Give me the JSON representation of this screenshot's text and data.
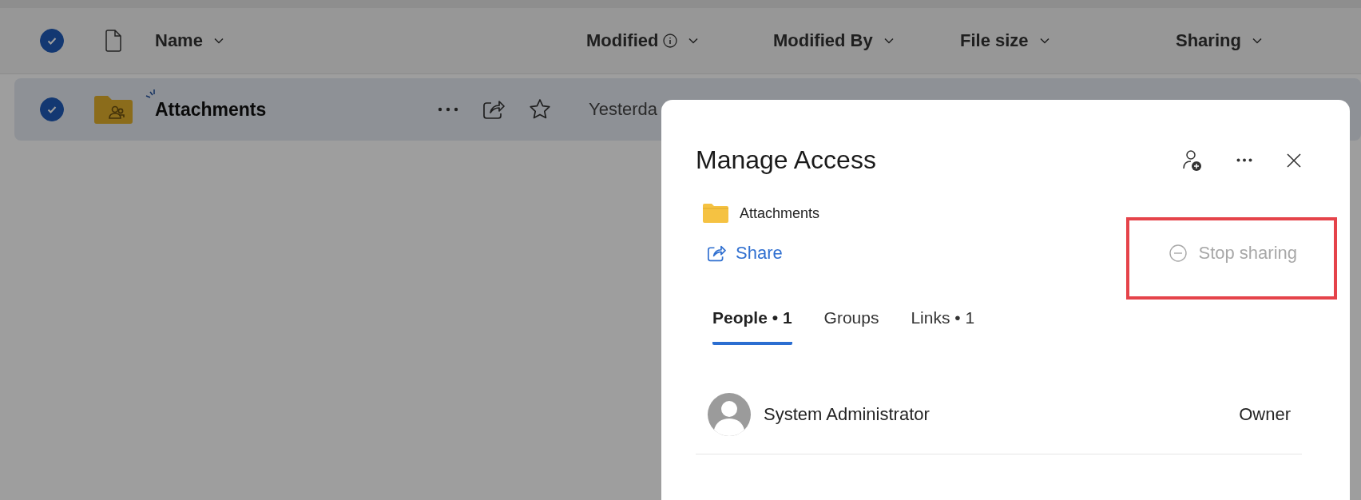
{
  "list": {
    "header": {
      "checked": true,
      "columns": [
        {
          "label": "Name",
          "info": false
        },
        {
          "label": "Modified",
          "info": true
        },
        {
          "label": "Modified By",
          "info": false
        },
        {
          "label": "File size",
          "info": false
        },
        {
          "label": "Sharing",
          "info": false
        }
      ]
    },
    "rows": [
      {
        "name": "Attachments",
        "checked": true,
        "selected": true,
        "modified": "Yesterda"
      }
    ]
  },
  "dialog": {
    "title": "Manage Access",
    "item": "Attachments",
    "share": "Share",
    "stop_sharing": {
      "label": "Stop sharing",
      "disabled": true
    },
    "tabs": [
      {
        "label": "People • 1",
        "selected": true
      },
      {
        "label": "Groups",
        "selected": false
      },
      {
        "label": "Links • 1",
        "selected": false
      }
    ],
    "people": [
      {
        "name": "System Administrator",
        "role": "Owner"
      }
    ]
  }
}
